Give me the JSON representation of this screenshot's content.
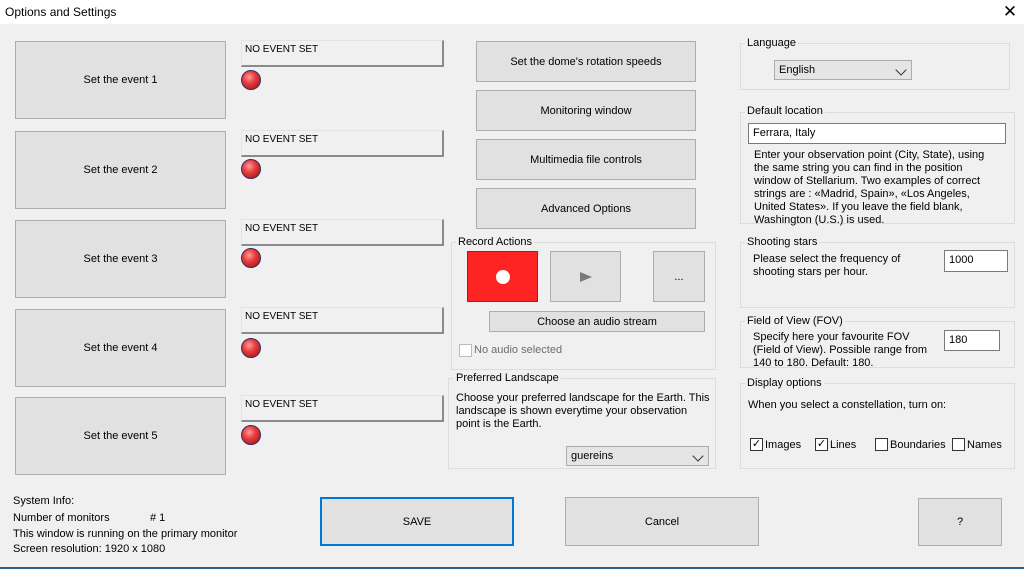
{
  "window": {
    "title": "Options and Settings",
    "close_glyph": "✕"
  },
  "events": [
    {
      "button": "Set the event 1",
      "status": "NO EVENT SET"
    },
    {
      "button": "Set the event 2",
      "status": "NO EVENT SET"
    },
    {
      "button": "Set the event 3",
      "status": "NO EVENT SET"
    },
    {
      "button": "Set the event 4",
      "status": "NO EVENT SET"
    },
    {
      "button": "Set the event 5",
      "status": "NO EVENT SET"
    }
  ],
  "middle_buttons": {
    "dome_speeds": "Set the dome's rotation speeds",
    "monitoring": "Monitoring window",
    "multimedia": "Multimedia file controls",
    "advanced": "Advanced Options"
  },
  "record_actions": {
    "title": "Record Actions",
    "more_label": "...",
    "audio_stream_button": "Choose an audio stream",
    "no_audio_label": "No audio selected",
    "no_audio_checked": false,
    "record_color": "#ff2424"
  },
  "landscape": {
    "title": "Preferred Landscape",
    "description": "Choose your preferred landscape for the Earth. This landscape is shown everytime your observation point is the Earth.",
    "selected": "guereins"
  },
  "language": {
    "title": "Language",
    "selected": "English"
  },
  "default_location": {
    "title": "Default location",
    "value": "Ferrara, Italy",
    "help": "Enter your observation point (City, State), using the same string you can find in the position window of Stellarium.  Two examples of correct strings are : «Madrid, Spain», «Los Angeles, United States». If you leave the field blank, Washington (U.S.) is used."
  },
  "shooting_stars": {
    "title": "Shooting stars",
    "label": "Please select the frequency of shooting stars per hour.",
    "value": "1000"
  },
  "fov": {
    "title": "Field of View (FOV)",
    "label": "Specify here your favourite FOV (Field of View). Possible range from 140 to 180. Default: 180.",
    "value": "180"
  },
  "display_options": {
    "title": "Display options",
    "label": "When you select a constellation, turn on:",
    "options": [
      {
        "label": "Images",
        "checked": true
      },
      {
        "label": "Lines",
        "checked": true
      },
      {
        "label": "Boundaries",
        "checked": false
      },
      {
        "label": "Names",
        "checked": false
      }
    ]
  },
  "system_info": {
    "header": "System Info:",
    "monitors_label": "Number of monitors",
    "monitors_value": "# 1",
    "window_line": "This window is running on the primary monitor",
    "resolution_line": "Screen resolution:  1920 x 1080"
  },
  "footer": {
    "save": "SAVE",
    "cancel": "Cancel",
    "help": "?"
  },
  "colors": {
    "focus_border": "#0078d7",
    "led_red": "#e63c3c",
    "record_red": "#ff2424"
  }
}
